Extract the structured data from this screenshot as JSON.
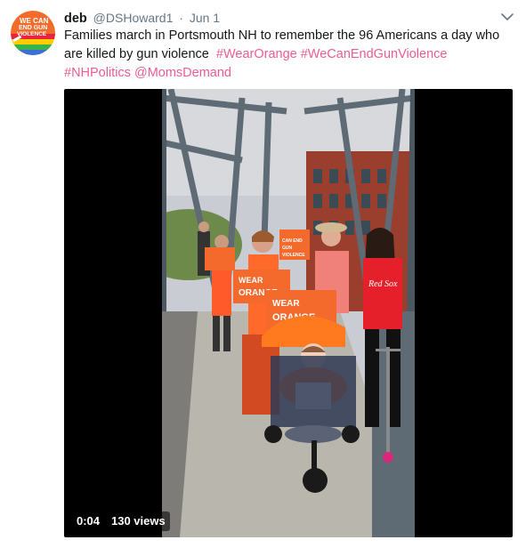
{
  "tweet": {
    "name": "deb",
    "handle": "@DSHoward1",
    "separator": "·",
    "date": "Jun 1",
    "text": "Families march in Portsmouth NH to remember the 96 Americans a day who are killed by gun violence",
    "hashtags": [
      "#WearOrange",
      "#WeCanEndGunViolence",
      "#NHPolitics"
    ],
    "mention": "@MomsDemand"
  },
  "avatar": {
    "icon": "we-can-end-gun-violence-logo",
    "logo_text": [
      "WE CAN",
      "END",
      "GUN",
      "VIOLENCE"
    ]
  },
  "video": {
    "time": "0:04",
    "views": "130 views",
    "signs": {
      "sign1": "CAN END GUN VIOLENCE",
      "sign2": "WEAR ORANGE",
      "sign3": "WEAR ORANGE"
    },
    "shirt_text": "Red Sox"
  },
  "colors": {
    "text": "#14171a",
    "muted": "#657786",
    "hashtag": "#ec5c92",
    "orange": "#f26b2a"
  }
}
